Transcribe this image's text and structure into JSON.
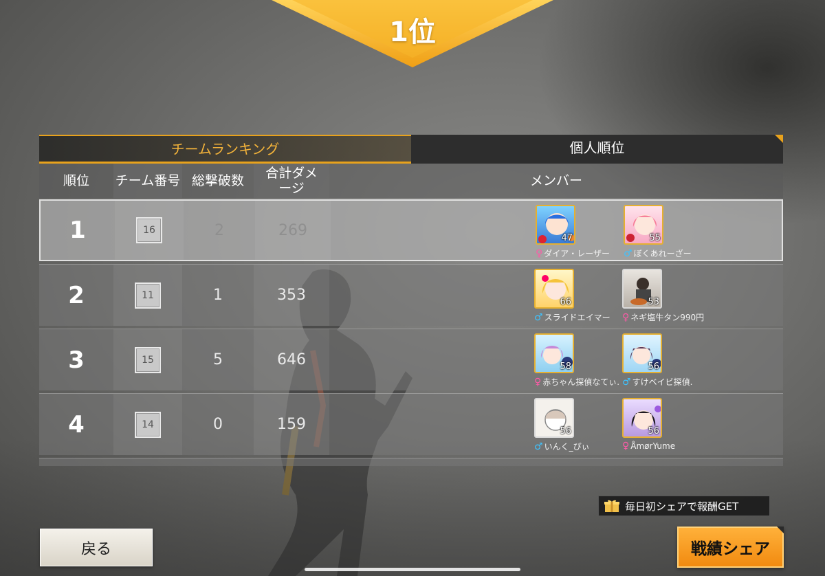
{
  "banner": {
    "rank": "1位"
  },
  "tabs": [
    {
      "label": "チームランキング",
      "active": true
    },
    {
      "label": "個人順位",
      "active": false
    }
  ],
  "headers": {
    "rank": "順位",
    "team_no": "チーム番号",
    "kills": "総撃破数",
    "damage": "合計ダメージ",
    "damage_line1": "合計ダメ",
    "damage_line2": "ージ",
    "members": "メンバー"
  },
  "rows": [
    {
      "rank": "1",
      "team": "16",
      "kills": "2",
      "damage": "269",
      "members": [
        {
          "level": "47",
          "gender": "female",
          "gender_icon": "♀",
          "name": "ダイア・レーザー",
          "avatar": "blue-hair-chibi"
        },
        {
          "level": "55",
          "gender": "male",
          "gender_icon": "♂",
          "name": "ぼくあれーざー",
          "avatar": "pink-hair-chibi"
        }
      ]
    },
    {
      "rank": "2",
      "team": "11",
      "kills": "1",
      "damage": "353",
      "members": [
        {
          "level": "66",
          "gender": "male",
          "gender_icon": "♂",
          "name": "スライドエイマー",
          "avatar": "blonde-chibi"
        },
        {
          "level": "53",
          "gender": "female",
          "gender_icon": "♀",
          "name": "ネギ塩牛タン990円",
          "avatar": "photo"
        }
      ]
    },
    {
      "rank": "3",
      "team": "15",
      "kills": "5",
      "damage": "646",
      "members": [
        {
          "level": "58",
          "gender": "female",
          "gender_icon": "♀",
          "name": "赤ちゃん探偵なてぃ.",
          "avatar": "purple-hair-chibi"
        },
        {
          "level": "56",
          "gender": "male",
          "gender_icon": "♂",
          "name": "すけベイビ探偵.",
          "avatar": "dark-hair-chibi"
        }
      ]
    },
    {
      "rank": "4",
      "team": "14",
      "kills": "0",
      "damage": "159",
      "members": [
        {
          "level": "56",
          "gender": "male",
          "gender_icon": "♂",
          "name": "いんく_ぴぃ",
          "avatar": "sketch-chibi"
        },
        {
          "level": "56",
          "gender": "female",
          "gender_icon": "♀",
          "name": "ÅmørYume",
          "avatar": "black-hair-chibi"
        }
      ]
    }
  ],
  "buttons": {
    "back": "戻る",
    "share": "戦績シェア",
    "reward_tag": "毎日初シェアで報酬GET"
  },
  "colors": {
    "accent_gold": "#e8a21c",
    "share_orange": "#f5a02a",
    "female": "#ff5aa8",
    "male": "#3ec3ff"
  },
  "icons": [
    "gift-icon",
    "female-icon",
    "male-icon"
  ]
}
